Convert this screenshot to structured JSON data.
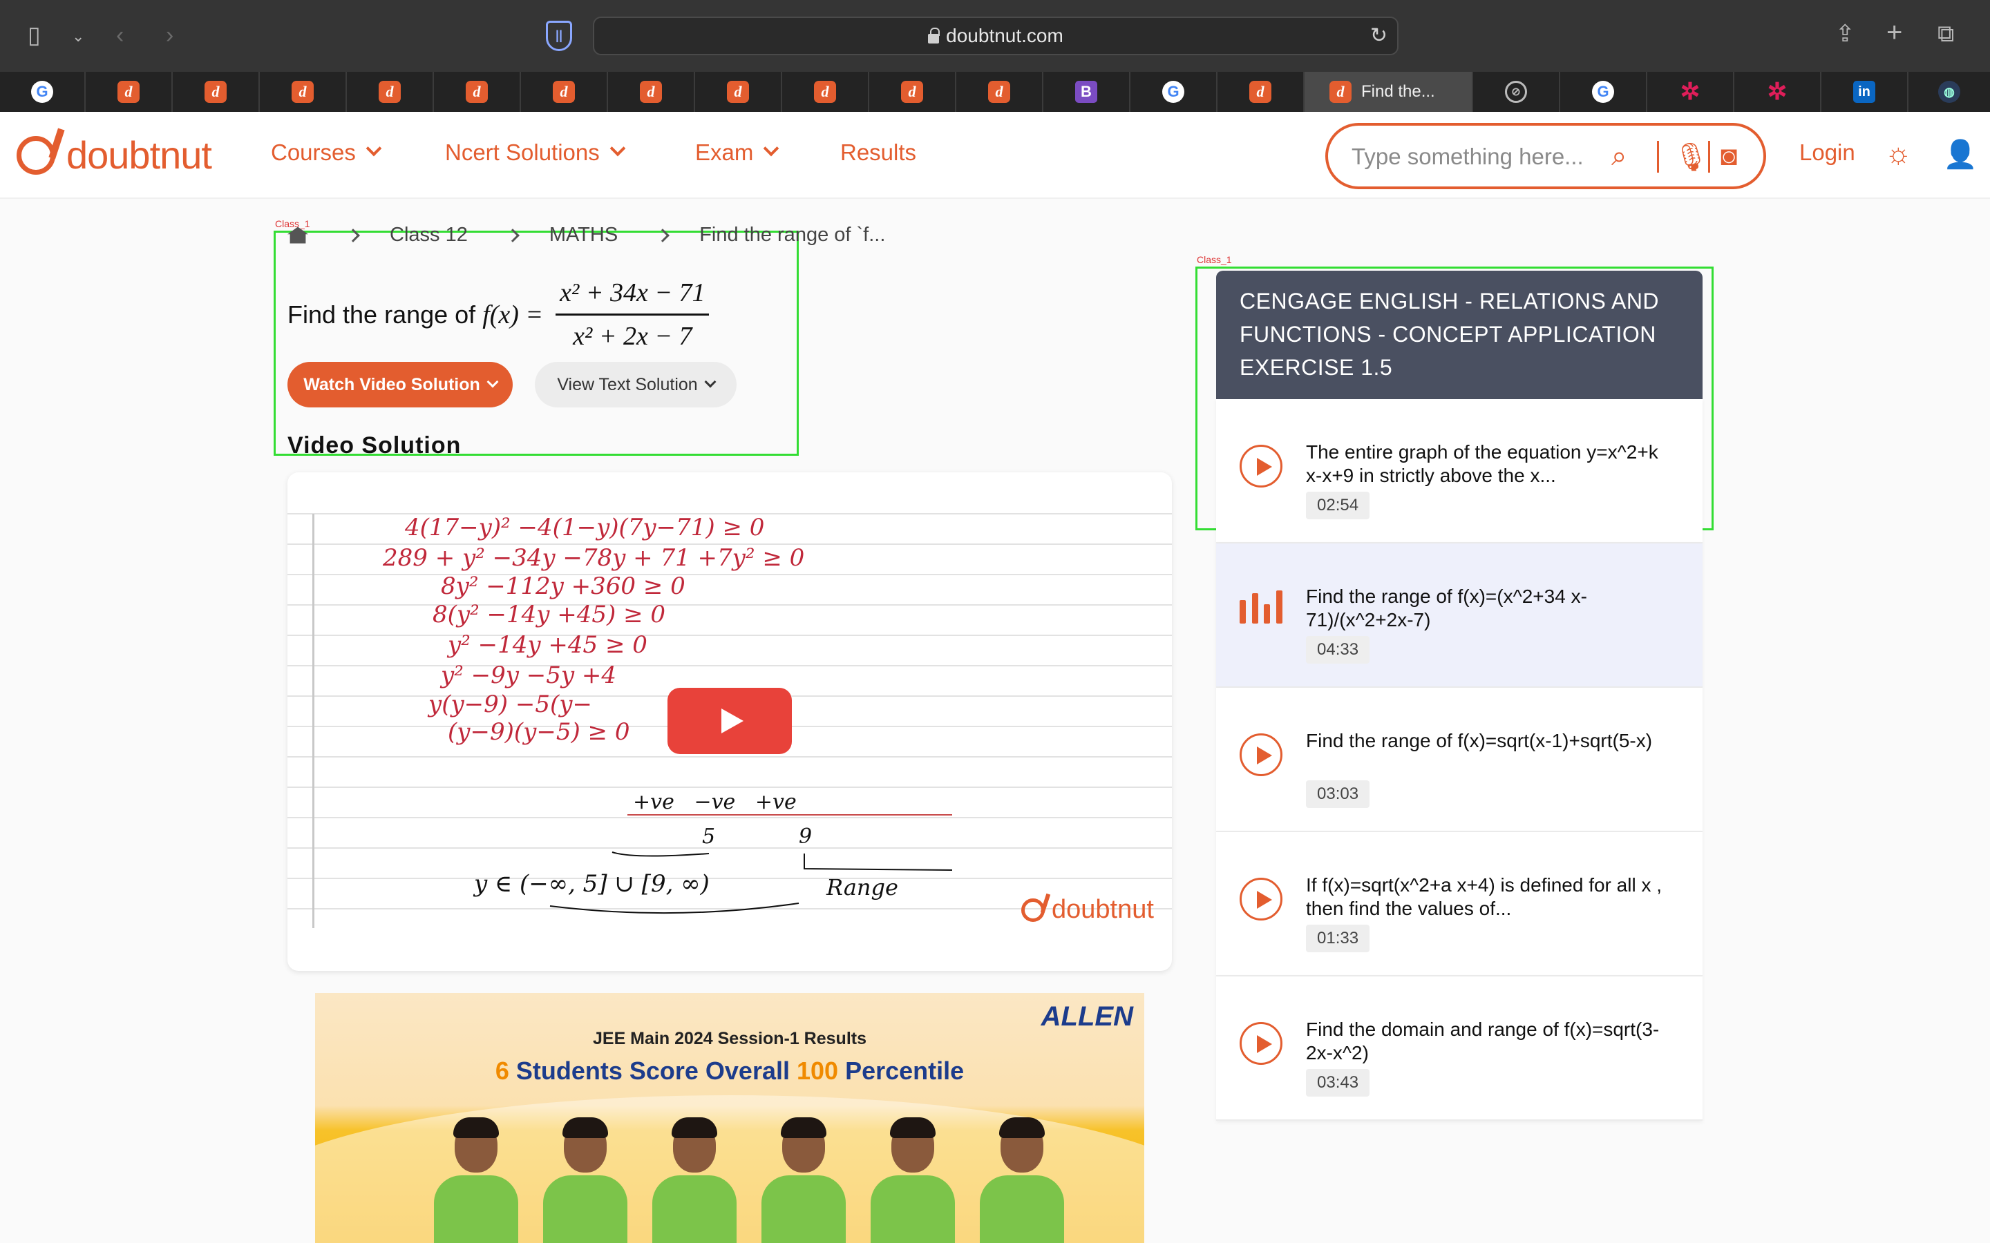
{
  "browser": {
    "url": "doubtnut.com",
    "active_tab_title": "Find the..."
  },
  "site": {
    "logo": "doubtnut",
    "nav": [
      "Courses",
      "Ncert Solutions",
      "Exam",
      "Results"
    ],
    "search_placeholder": "Type something here...",
    "login": "Login"
  },
  "breadcrumb": {
    "items": [
      "Class 12",
      "MATHS",
      "Find the range of `f..."
    ]
  },
  "question": {
    "text": "Find the range of",
    "fx": "f(x) =",
    "numerator": "x² + 34x − 71",
    "denominator": "x² + 2x − 7"
  },
  "buttons": {
    "watch": "Watch Video Solution",
    "view": "View Text Solution"
  },
  "video": {
    "section_title": "Video Solution",
    "watermark": "doubtnut",
    "handwriting": [
      "4(17−y)² −4(1−y)(7y−71) ≥ 0",
      "289 + y² −34y −78y + 71 +7y² ≥ 0",
      "8y² −112y +360 ≥ 0",
      "8(y² −14y +45) ≥ 0",
      "y² −14y +45 ≥ 0",
      "y² −9y −5y +4",
      "y(y−9) −5(y−",
      "(y−9)(y−5) ≥ 0",
      "+ve   −ve   +ve",
      "5",
      "9",
      "y ∈ (−∞, 5] ∪ [9, ∞)",
      "Range"
    ]
  },
  "ad": {
    "brand": "ALLEN",
    "line1": "JEE Main 2024 Session-1 Results",
    "line2_num1": "6",
    "line2_mid": " Students Score Overall ",
    "line2_num2": "100",
    "line2_end": " Percentile"
  },
  "annotation_labels": {
    "left": "Class_1",
    "right": "Class_1"
  },
  "panel": {
    "header": "CENGAGE ENGLISH  -  RELATIONS AND FUNCTIONS  -  CONCEPT APPLICATION EXERCISE 1.5",
    "items": [
      {
        "title": "The entire graph of the equation y=x^2+k x-x+9 in strictly above the x...",
        "time": "02:54",
        "playing": false
      },
      {
        "title": "Find the range of f(x)=(x^2+34 x-71)/(x^2+2x-7)",
        "time": "04:33",
        "playing": true
      },
      {
        "title": "Find the range of f(x)=sqrt(x-1)+sqrt(5-x)",
        "time": "03:03",
        "playing": false
      },
      {
        "title": "If f(x)=sqrt(x^2+a x+4) is defined for all x , then find the values of...",
        "time": "01:33",
        "playing": false
      },
      {
        "title": "Find the domain and range of f(x)=sqrt(3-2x-x^2)",
        "time": "03:43",
        "playing": false
      }
    ]
  },
  "colors": {
    "brand": "#e35d2f",
    "panel_header": "#4a5061",
    "annotation_box": "#33dd33"
  }
}
